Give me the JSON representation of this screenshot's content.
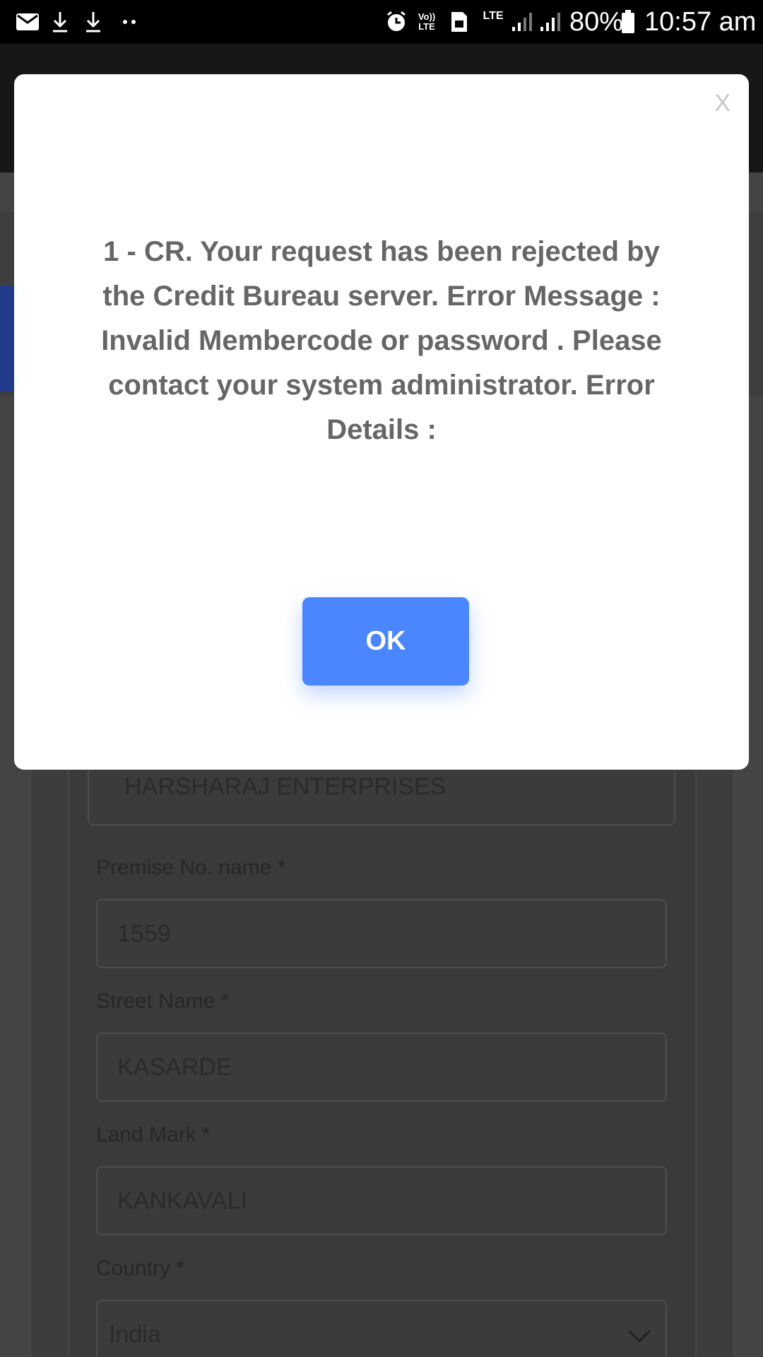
{
  "status_bar": {
    "battery": "80%",
    "time": "10:57 am",
    "network_badge": "LTE",
    "volte_badge": "Vo)) LTE",
    "icons": [
      "mail-icon",
      "download-icon",
      "download-icon",
      "more-dots-icon",
      "alarm-icon",
      "volte-icon",
      "sim-icon",
      "lte-icon",
      "signal-icon",
      "signal-icon",
      "battery-icon"
    ]
  },
  "dialog": {
    "close_label": "X",
    "message": "1 - CR. Your request has been rejected by the Credit Bureau server. Error Message : Invalid Membercode or password . Please contact your system administrator. Error Details :",
    "ok_label": "OK"
  },
  "form": {
    "business_name_value": "HARSHARAJ ENTERPRISES",
    "premise_label": "Premise No. name *",
    "premise_value": "1559",
    "street_label": "Street Name *",
    "street_value": "KASARDE",
    "landmark_label": "Land Mark *",
    "landmark_value": "KANKAVALI",
    "country_label": "Country *",
    "country_value": "India"
  },
  "colors": {
    "ok_button": "#4a86ff",
    "message_text": "#666666",
    "overlay_bg": "#3a3a3a"
  }
}
